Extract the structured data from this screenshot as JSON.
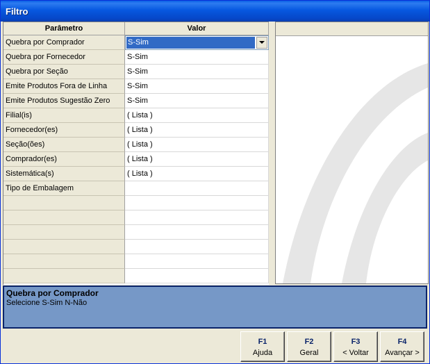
{
  "window": {
    "title": "Filtro"
  },
  "grid": {
    "headers": {
      "param": "Parâmetro",
      "value": "Valor"
    },
    "rows": [
      {
        "param": "Quebra por Comprador",
        "value": "S-Sim"
      },
      {
        "param": "Quebra por Fornecedor",
        "value": "S-Sim"
      },
      {
        "param": "Quebra por Seção",
        "value": "S-Sim"
      },
      {
        "param": "Emite Produtos Fora de Linha",
        "value": "S-Sim"
      },
      {
        "param": "Emite Produtos Sugestão Zero",
        "value": "S-Sim"
      },
      {
        "param": "Filial(is)",
        "value": "( Lista )"
      },
      {
        "param": "Fornecedor(es)",
        "value": "( Lista )"
      },
      {
        "param": "Seção(ões)",
        "value": "( Lista )"
      },
      {
        "param": "Comprador(es)",
        "value": "( Lista )"
      },
      {
        "param": "Sistemática(s)",
        "value": "( Lista )"
      },
      {
        "param": "Tipo de Embalagem",
        "value": ""
      },
      {
        "param": "",
        "value": ""
      },
      {
        "param": "",
        "value": ""
      },
      {
        "param": "",
        "value": ""
      },
      {
        "param": "",
        "value": ""
      },
      {
        "param": "",
        "value": ""
      },
      {
        "param": "",
        "value": ""
      }
    ]
  },
  "description": {
    "title": "Quebra por Comprador",
    "text": "Selecione S-Sim N-Não"
  },
  "buttons": [
    {
      "key": "F1",
      "label": "Ajuda"
    },
    {
      "key": "F2",
      "label": "Geral"
    },
    {
      "key": "F3",
      "label": "< Voltar"
    },
    {
      "key": "F4",
      "label": "Avançar >"
    }
  ],
  "colors": {
    "selection": "#316ac5",
    "description_bg": "#7698c7",
    "titlebar": "#0758e0"
  },
  "icons": {
    "combo": "chevron-down-icon"
  }
}
